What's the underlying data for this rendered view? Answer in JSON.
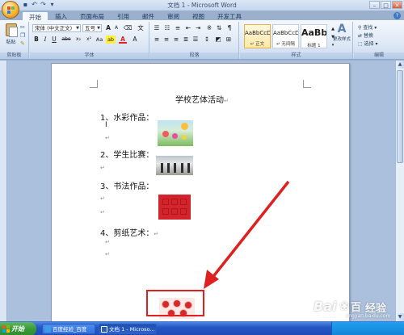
{
  "window": {
    "title": "文档 1 - Microsoft Word",
    "controls": {
      "minimize": "–",
      "maximize": "□",
      "close": "✕"
    }
  },
  "quick_access": [
    "save-icon",
    "undo-icon",
    "redo-icon",
    "customize-icon"
  ],
  "ribbon": {
    "tabs": [
      "开始",
      "插入",
      "页面布局",
      "引用",
      "邮件",
      "审阅",
      "视图",
      "开发工具"
    ],
    "active_tab": "开始",
    "clipboard": {
      "paste_label": "粘贴",
      "group_label": "剪贴板"
    },
    "font": {
      "font_name": "宋体 (中文正文)",
      "font_size": "五号",
      "group_label": "字体",
      "grow": "A",
      "shrink": "A",
      "bold": "B",
      "italic": "I",
      "underline": "U",
      "strike": "abe",
      "subscript": "x₂",
      "superscript": "x²",
      "change_case": "Aa",
      "font_color": "A",
      "highlight": "ab"
    },
    "paragraph": {
      "group_label": "段落"
    },
    "styles": {
      "group_label": "样式",
      "items": [
        {
          "sample": "AaBbCcDd",
          "name": "↵ 正文",
          "selected": true
        },
        {
          "sample": "AaBbCcDd",
          "name": "↵ 无间隔",
          "selected": false
        },
        {
          "sample": "AaBb",
          "name": "标题 1",
          "selected": false
        }
      ],
      "change_styles": "更改样式"
    },
    "editing": {
      "group_label": "编辑",
      "find": "查找 ▾",
      "replace": "替换",
      "select": "选择 ▾"
    }
  },
  "document": {
    "title": "学校艺体活动",
    "items": [
      "1、水彩作品：",
      "2、学生比赛：",
      "3、书法作品：",
      "4、剪纸艺术："
    ],
    "paragraph_mark": "↵"
  },
  "taskbar": {
    "start": "开始",
    "tasks": [
      {
        "label": "百度经验_百度",
        "active": false
      },
      {
        "label": "文档 1 - Microso...",
        "active": true
      }
    ]
  },
  "watermark": {
    "brand": "Bai",
    "brand_suffix": "百",
    "jingyan": "经验",
    "url": "jingyan.baidu.com"
  }
}
